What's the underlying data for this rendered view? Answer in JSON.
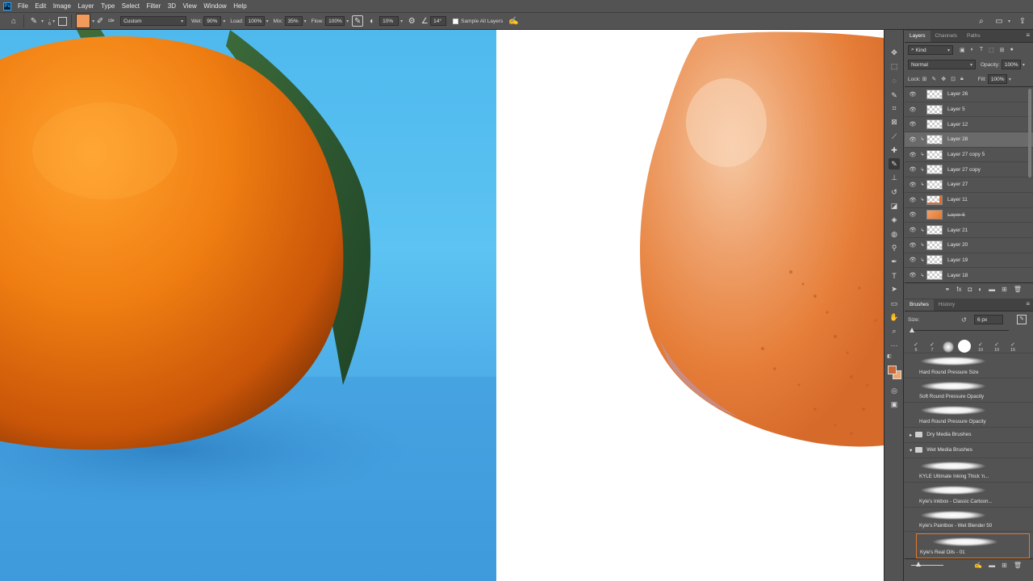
{
  "app_icon_label": "Ps",
  "menu": [
    "File",
    "Edit",
    "Image",
    "Layer",
    "Type",
    "Select",
    "Filter",
    "3D",
    "View",
    "Window",
    "Help"
  ],
  "options_bar": {
    "brush_size": "6",
    "preset": "Custom",
    "wet_label": "Wet:",
    "wet_value": "90%",
    "load_label": "Load:",
    "load_value": "100%",
    "mix_label": "Mix:",
    "mix_value": "35%",
    "flow_label": "Flow:",
    "flow_value": "100%",
    "smoothing_value": "10%",
    "angle_value": "14°",
    "sample_all_label": "Sample All Layers",
    "foreground_color": "#f29a5c"
  },
  "layers_panel": {
    "tabs": [
      "Layers",
      "Channels",
      "Paths"
    ],
    "filter_kind": "Kind",
    "blend_mode": "Normal",
    "opacity_label": "Opacity:",
    "opacity_value": "100%",
    "lock_label": "Lock:",
    "fill_label": "Fill:",
    "fill_value": "100%",
    "layers": [
      {
        "name": "Layer 26",
        "clipped": false,
        "selected": false,
        "thumb": "blank"
      },
      {
        "name": "Layer 5",
        "clipped": false,
        "selected": false,
        "thumb": "blank"
      },
      {
        "name": "Layer 12",
        "clipped": false,
        "selected": false,
        "thumb": "blank"
      },
      {
        "name": "Layer 28",
        "clipped": true,
        "selected": true,
        "thumb": "blank"
      },
      {
        "name": "Layer 27 copy 5",
        "clipped": true,
        "selected": false,
        "thumb": "blank"
      },
      {
        "name": "Layer 27 copy",
        "clipped": true,
        "selected": false,
        "thumb": "blank"
      },
      {
        "name": "Layer 27",
        "clipped": true,
        "selected": false,
        "thumb": "blank"
      },
      {
        "name": "Layer 11",
        "clipped": true,
        "selected": false,
        "thumb": "dot"
      },
      {
        "name": "Layer 6",
        "clipped": false,
        "selected": false,
        "thumb": "orange",
        "hidden": true
      },
      {
        "name": "Layer 21",
        "clipped": true,
        "selected": false,
        "thumb": "blank"
      },
      {
        "name": "Layer 20",
        "clipped": true,
        "selected": false,
        "thumb": "blank"
      },
      {
        "name": "Layer 19",
        "clipped": true,
        "selected": false,
        "thumb": "blank"
      },
      {
        "name": "Layer 18",
        "clipped": true,
        "selected": false,
        "thumb": "blank"
      }
    ]
  },
  "brushes_panel": {
    "tabs": [
      "Brushes",
      "History"
    ],
    "size_label": "Size:",
    "size_value": "6 px",
    "tip_sizes": [
      "6",
      "7",
      "",
      "",
      "10",
      "10",
      "15"
    ],
    "brushes": [
      {
        "name": "Hard Round Pressure Size"
      },
      {
        "name": "Soft Round Pressure Opacity"
      },
      {
        "name": "Hard Round Pressure Opacity"
      }
    ],
    "folders": [
      {
        "name": "Dry Media Brushes",
        "open": false
      },
      {
        "name": "Wet Media Brushes",
        "open": true
      }
    ],
    "wet_brushes": [
      {
        "name": "KYLE Ultimate Inking Thick 'n...",
        "selected": false
      },
      {
        "name": "Kyle's Inkbox - Classic Cartoon...",
        "selected": false
      },
      {
        "name": "Kyle's Paintbox - Wet Blender 50",
        "selected": false
      },
      {
        "name": "Kyle's Real Oils - 01",
        "selected": true
      }
    ]
  },
  "colors": {
    "foreground": "#c8693a",
    "background": "#f2a56a",
    "accent_selection": "#e3782c"
  }
}
